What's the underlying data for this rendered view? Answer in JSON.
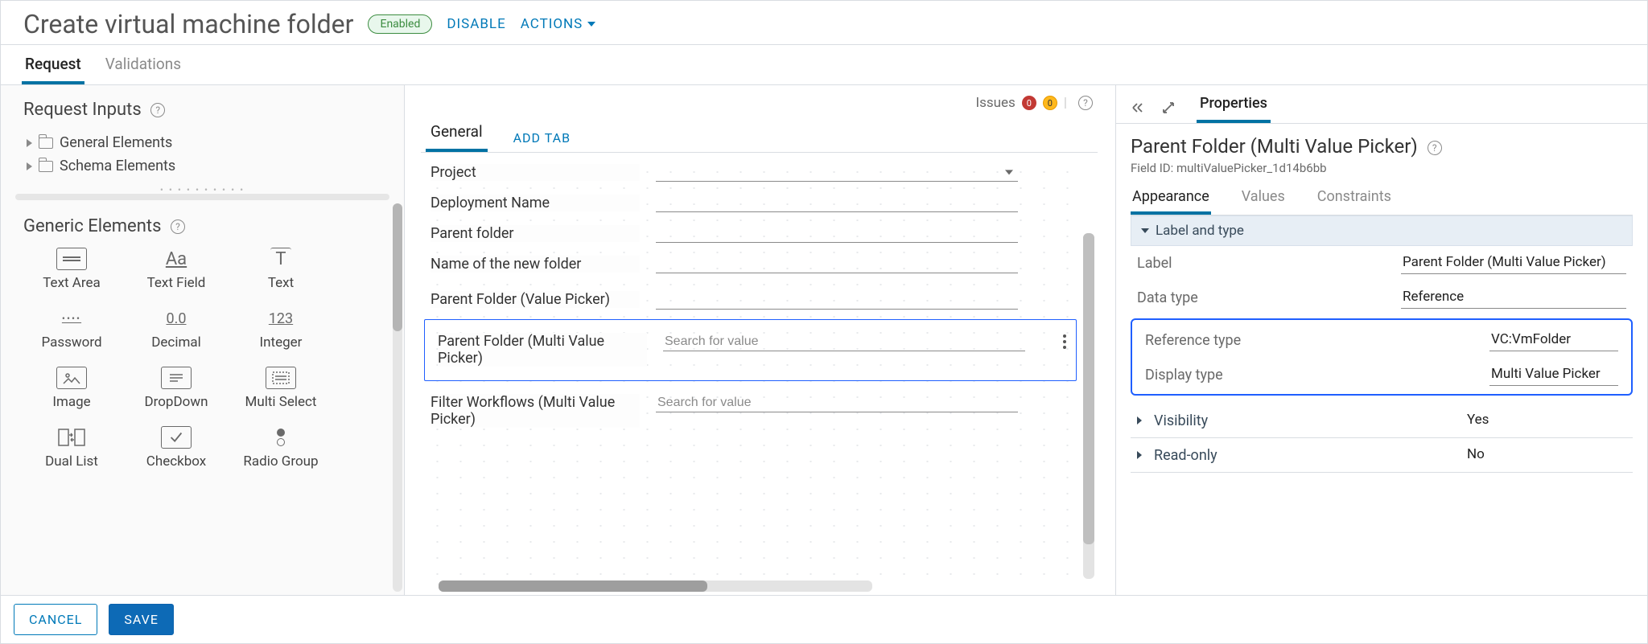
{
  "header": {
    "title": "Create virtual machine folder",
    "status_badge": "Enabled",
    "disable_label": "DISABLE",
    "actions_label": "ACTIONS"
  },
  "top_tabs": {
    "request": "Request",
    "validations": "Validations"
  },
  "left_panel": {
    "request_inputs_title": "Request Inputs",
    "tree": {
      "general_elements": "General Elements",
      "schema_elements": "Schema Elements"
    },
    "generic_elements_title": "Generic Elements",
    "palette": [
      {
        "name": "Text Area"
      },
      {
        "name": "Text Field"
      },
      {
        "name": "Text"
      },
      {
        "name": "Password"
      },
      {
        "name": "Decimal"
      },
      {
        "name": "Integer"
      },
      {
        "name": "Image"
      },
      {
        "name": "DropDown"
      },
      {
        "name": "Multi Select"
      },
      {
        "name": "Dual List"
      },
      {
        "name": "Checkbox"
      },
      {
        "name": "Radio Group"
      }
    ],
    "palette_icons": {
      "password_glyph": "••••",
      "decimal_glyph": "0.0",
      "integer_glyph": "123",
      "textfield_glyph": "Aa"
    }
  },
  "canvas": {
    "issues_label": "Issues",
    "issues_red_count": "0",
    "issues_yellow_count": "0",
    "tab_general": "General",
    "add_tab": "ADD TAB",
    "fields": [
      {
        "label": "Project",
        "type": "select",
        "placeholder": ""
      },
      {
        "label": "Deployment Name",
        "type": "text",
        "placeholder": ""
      },
      {
        "label": "Parent folder",
        "type": "text",
        "placeholder": ""
      },
      {
        "label": "Name of the new folder",
        "type": "text",
        "placeholder": ""
      },
      {
        "label": "Parent Folder (Value Picker)",
        "type": "text",
        "placeholder": ""
      },
      {
        "label": "Parent Folder (Multi Value Picker)",
        "type": "search",
        "placeholder": "Search for value",
        "selected": true
      },
      {
        "label": "Filter Workflows (Multi Value Picker)",
        "type": "search",
        "placeholder": "Search for value"
      }
    ]
  },
  "right_panel": {
    "properties_tab": "Properties",
    "panel_title": "Parent Folder (Multi Value Picker)",
    "field_id_label": "Field ID: multiValuePicker_1d14b6bb",
    "tabs": {
      "appearance": "Appearance",
      "values": "Values",
      "constraints": "Constraints"
    },
    "acc_label_and_type": "Label and type",
    "props": {
      "label": {
        "k": "Label",
        "v": "Parent Folder (Multi Value Picker)"
      },
      "data_type": {
        "k": "Data type",
        "v": "Reference"
      },
      "reference_type": {
        "k": "Reference type",
        "v": "VC:VmFolder"
      },
      "display_type": {
        "k": "Display type",
        "v": "Multi Value Picker"
      }
    },
    "acc_visibility": {
      "title": "Visibility",
      "value": "Yes"
    },
    "acc_readonly": {
      "title": "Read-only",
      "value": "No"
    }
  },
  "footer": {
    "cancel": "CANCEL",
    "save": "SAVE"
  }
}
